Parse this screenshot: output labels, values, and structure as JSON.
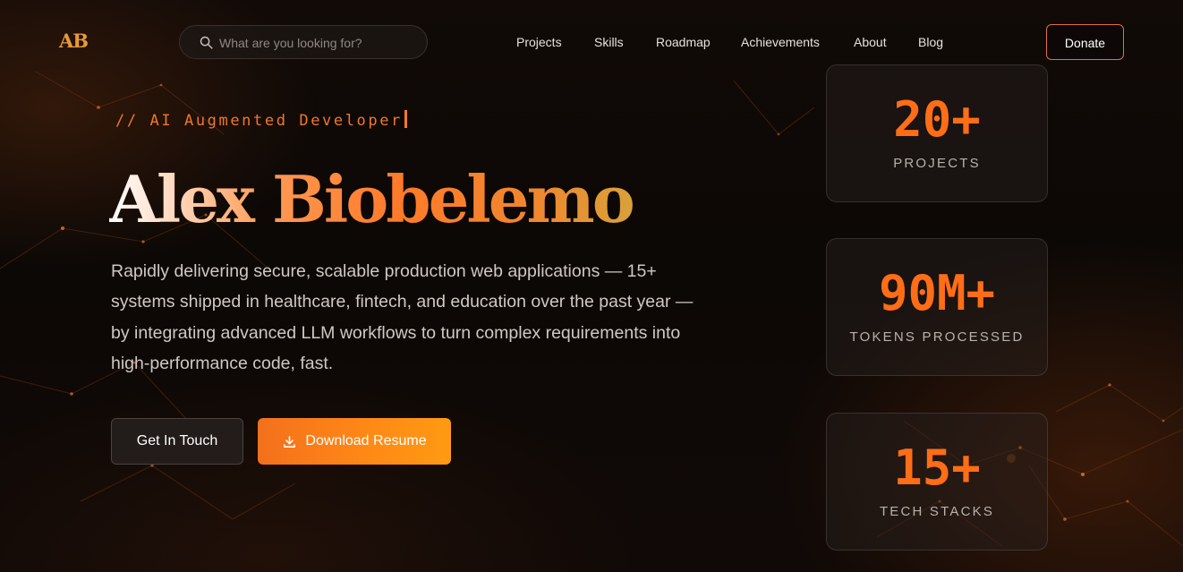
{
  "brand": {
    "logo": "AB",
    "accent": "#ff6d17"
  },
  "search": {
    "placeholder": "What are you looking for?",
    "icon": "search-icon"
  },
  "nav": {
    "items": [
      {
        "label": "Projects"
      },
      {
        "label": "Skills"
      },
      {
        "label": "Roadmap"
      },
      {
        "label": "Achievements"
      },
      {
        "label": "About"
      },
      {
        "label": "Blog"
      }
    ],
    "donate_label": "Donate"
  },
  "hero": {
    "tagline": "// AI Augmented Developer",
    "name": "Alex Biobelemo",
    "description": "Rapidly delivering secure, scalable production web applications — 15+ systems shipped in healthcare, fintech, and education over the past year — by integrating advanced LLM workflows to turn complex requirements into high-performance code, fast.",
    "contact_label": "Get In Touch",
    "download_label": "Download Resume",
    "download_icon": "download-icon"
  },
  "stats": [
    {
      "value": "20+",
      "label": "PROJECTS"
    },
    {
      "value": "90M+",
      "label": "TOKENS PROCESSED"
    },
    {
      "value": "15+",
      "label": "TECH STACKS"
    }
  ]
}
